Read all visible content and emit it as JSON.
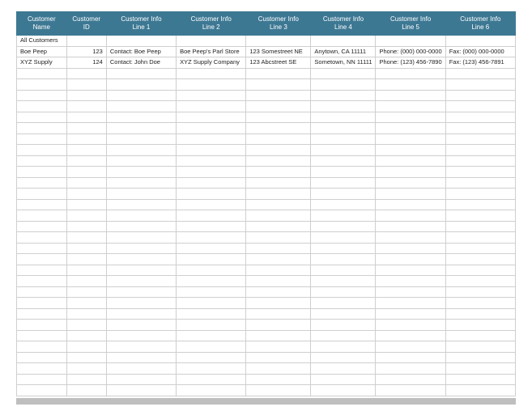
{
  "headers": [
    "Customer\nName",
    "Customer\nID",
    "Customer Info\nLine 1",
    "Customer Info\nLine 2",
    "Customer Info\nLine 3",
    "Customer Info\nLine 4",
    "Customer Info\nLine 5",
    "Customer Info\nLine 6"
  ],
  "group_label": "All Customers",
  "rows": [
    {
      "name": "Boe Peep",
      "id": "123",
      "line1": "Contact: Boe Peep",
      "line2": "Boe Peep's Parl Store",
      "line3": "123 Somestreet NE",
      "line4": "Anytown, CA 11111",
      "line5": "Phone: (000) 000-0000",
      "line6": "Fax: (000) 000-0000"
    },
    {
      "name": "XYZ Supply",
      "id": "124",
      "line1": "Contact: John Doe",
      "line2": "XYZ Supply Company",
      "line3": "123 Abcstreet SE",
      "line4": "Sometown, NN 11111",
      "line5": "Phone: (123) 456-7890",
      "line6": "Fax: (123) 456-7891"
    }
  ],
  "empty_row_count": 30
}
